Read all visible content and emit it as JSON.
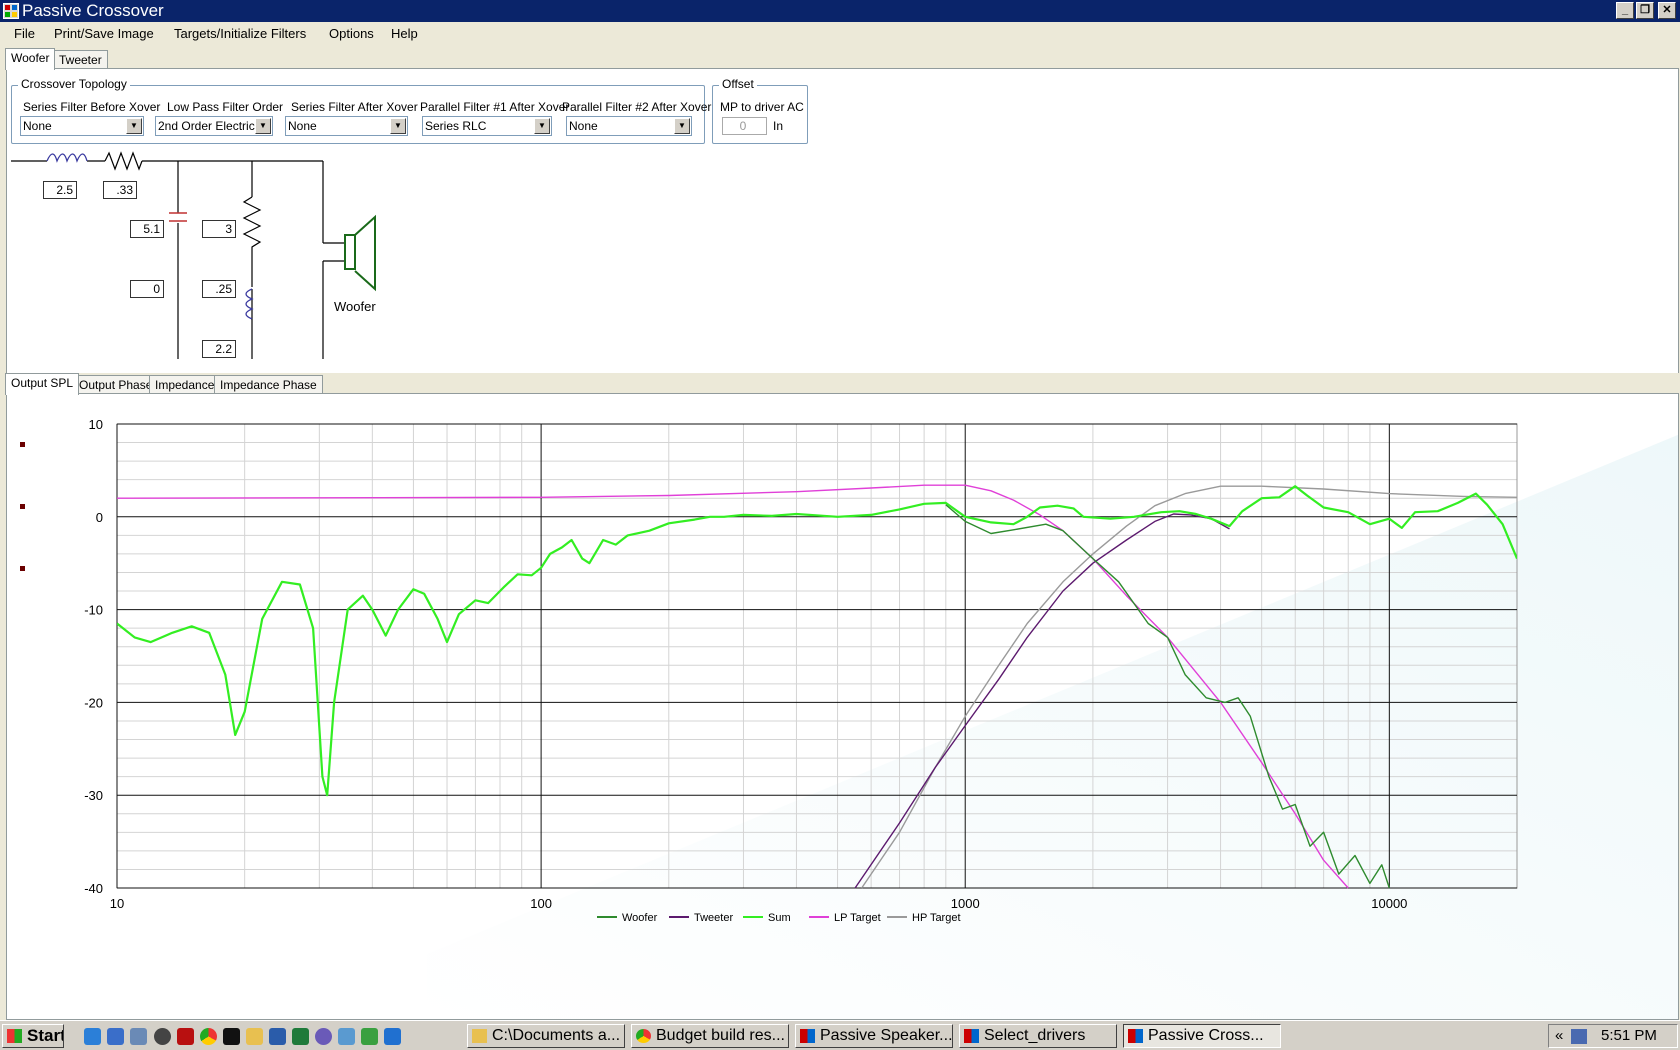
{
  "window": {
    "title": "Passive Crossover"
  },
  "menu": [
    "File",
    "Print/Save Image",
    "Targets/Initialize Filters",
    "Options",
    "Help"
  ],
  "driver_tabs": [
    {
      "label": "Woofer",
      "active": true
    },
    {
      "label": "Tweeter",
      "active": false
    }
  ],
  "topology": {
    "group_title": "Crossover Topology",
    "fields": [
      {
        "label": "Series Filter Before Xover",
        "value": "None"
      },
      {
        "label": "Low Pass Filter Order",
        "value": "2nd Order Electrical"
      },
      {
        "label": "Series Filter After Xover",
        "value": "None"
      },
      {
        "label": "Parallel Filter #1 After Xover",
        "value": "Series RLC"
      },
      {
        "label": "Parallel Filter #2 After Xover",
        "value": "None"
      }
    ]
  },
  "offset": {
    "group_title": "Offset",
    "label": "MP to driver AC",
    "value": "0",
    "unit": "In"
  },
  "schematic": {
    "series_inductor": "2.5",
    "series_resistor": ".33",
    "shunt_cap": "5.1",
    "shunt_res": "0",
    "rlc_res": "3",
    "rlc_ind": ".25",
    "rlc_cap": "2.2",
    "driver_label": "Woofer"
  },
  "chart_tabs": [
    {
      "label": "Output SPL",
      "active": true
    },
    {
      "label": "Output Phase",
      "active": false
    },
    {
      "label": "Impedance",
      "active": false
    },
    {
      "label": "Impedance Phase",
      "active": false
    }
  ],
  "chart_data": {
    "type": "line",
    "xscale": "log",
    "xlim": [
      10,
      20000
    ],
    "ylim": [
      -40,
      10
    ],
    "x_ticks": [
      "10",
      "100",
      "1000",
      "10000"
    ],
    "y_ticks": [
      "10",
      "0",
      "-10",
      "-20",
      "-30",
      "-40"
    ],
    "grid": true,
    "legend_position": "bottom",
    "series": [
      {
        "name": "Woofer",
        "color": "#2e8b2e",
        "points": [
          [
            900,
            1.3
          ],
          [
            1000,
            -0.5
          ],
          [
            1150,
            -1.8
          ],
          [
            1300,
            -1.4
          ],
          [
            1550,
            -0.8
          ],
          [
            1700,
            -1.5
          ],
          [
            2000,
            -4.5
          ],
          [
            2300,
            -7
          ],
          [
            2700,
            -11.5
          ],
          [
            3000,
            -13
          ],
          [
            3300,
            -17
          ],
          [
            3700,
            -19.5
          ],
          [
            4100,
            -20
          ],
          [
            4400,
            -19.5
          ],
          [
            4700,
            -21.5
          ],
          [
            5200,
            -28
          ],
          [
            5600,
            -31.5
          ],
          [
            6000,
            -31
          ],
          [
            6500,
            -35.5
          ],
          [
            7000,
            -34
          ],
          [
            7600,
            -38.5
          ],
          [
            8300,
            -36.5
          ],
          [
            9000,
            -39.5
          ],
          [
            9600,
            -37.5
          ],
          [
            10000,
            -40
          ]
        ]
      },
      {
        "name": "Tweeter",
        "color": "#5c1a6e",
        "points": [
          [
            550,
            -40
          ],
          [
            700,
            -33
          ],
          [
            850,
            -27
          ],
          [
            1000,
            -22.5
          ],
          [
            1200,
            -17.5
          ],
          [
            1400,
            -13
          ],
          [
            1700,
            -8
          ],
          [
            2000,
            -5
          ],
          [
            2400,
            -2.5
          ],
          [
            2800,
            -0.5
          ],
          [
            3100,
            0.3
          ],
          [
            3400,
            0.2
          ],
          [
            3800,
            -0.2
          ],
          [
            4200,
            -1.3
          ]
        ]
      },
      {
        "name": "Sum",
        "color": "#33ee22",
        "points": [
          [
            10,
            -11.5
          ],
          [
            11,
            -13
          ],
          [
            12,
            -13.5
          ],
          [
            13.5,
            -12.5
          ],
          [
            15,
            -11.8
          ],
          [
            16.5,
            -12.5
          ],
          [
            18,
            -17
          ],
          [
            19,
            -23.5
          ],
          [
            20,
            -21
          ],
          [
            22,
            -11
          ],
          [
            24.5,
            -7
          ],
          [
            27,
            -7.3
          ],
          [
            29,
            -12
          ],
          [
            30.5,
            -28
          ],
          [
            31.3,
            -30
          ],
          [
            32.5,
            -20
          ],
          [
            35,
            -10
          ],
          [
            38,
            -8.5
          ],
          [
            40,
            -10
          ],
          [
            43,
            -12.8
          ],
          [
            46,
            -10
          ],
          [
            50,
            -7.8
          ],
          [
            53,
            -8.3
          ],
          [
            57,
            -11
          ],
          [
            60,
            -13.5
          ],
          [
            64,
            -10.5
          ],
          [
            70,
            -9
          ],
          [
            75,
            -9.3
          ],
          [
            82,
            -7.5
          ],
          [
            88,
            -6.2
          ],
          [
            95,
            -6.3
          ],
          [
            100,
            -5.5
          ],
          [
            105,
            -4
          ],
          [
            112,
            -3.3
          ],
          [
            118,
            -2.5
          ],
          [
            125,
            -4.5
          ],
          [
            130,
            -5
          ],
          [
            140,
            -2.5
          ],
          [
            150,
            -3
          ],
          [
            160,
            -2
          ],
          [
            180,
            -1.5
          ],
          [
            200,
            -0.7
          ],
          [
            230,
            -0.3
          ],
          [
            250,
            0
          ],
          [
            270,
            0
          ],
          [
            300,
            0.2
          ],
          [
            350,
            0.1
          ],
          [
            400,
            0.3
          ],
          [
            500,
            0
          ],
          [
            600,
            0.2
          ],
          [
            700,
            0.8
          ],
          [
            800,
            1.4
          ],
          [
            900,
            1.5
          ],
          [
            1000,
            0
          ],
          [
            1150,
            -0.6
          ],
          [
            1300,
            -0.8
          ],
          [
            1400,
            0
          ],
          [
            1500,
            1
          ],
          [
            1650,
            1.2
          ],
          [
            1800,
            0.9
          ],
          [
            1900,
            0
          ],
          [
            2200,
            -0.2
          ],
          [
            2500,
            0
          ],
          [
            2900,
            0.5
          ],
          [
            3200,
            0.6
          ],
          [
            3500,
            0.3
          ],
          [
            3800,
            -0.2
          ],
          [
            4200,
            -1
          ],
          [
            4500,
            0.6
          ],
          [
            5000,
            2
          ],
          [
            5500,
            2.1
          ],
          [
            6000,
            3.3
          ],
          [
            6400,
            2.3
          ],
          [
            7000,
            1
          ],
          [
            8000,
            0.5
          ],
          [
            9000,
            -0.8
          ],
          [
            10000,
            -0.2
          ],
          [
            10700,
            -1.2
          ],
          [
            11500,
            0.5
          ],
          [
            13000,
            0.6
          ],
          [
            14500,
            1.5
          ],
          [
            16000,
            2.5
          ],
          [
            17000,
            1.3
          ],
          [
            18500,
            -0.8
          ],
          [
            20000,
            -4.5
          ]
        ]
      },
      {
        "name": "LP Target",
        "color": "#e040d8",
        "points": [
          [
            10,
            2
          ],
          [
            100,
            2.1
          ],
          [
            200,
            2.3
          ],
          [
            400,
            2.7
          ],
          [
            600,
            3.1
          ],
          [
            800,
            3.4
          ],
          [
            1000,
            3.4
          ],
          [
            1150,
            2.8
          ],
          [
            1300,
            1.8
          ],
          [
            1500,
            0.2
          ],
          [
            1700,
            -1.5
          ],
          [
            2000,
            -4.5
          ],
          [
            2400,
            -8.5
          ],
          [
            3000,
            -13
          ],
          [
            4000,
            -20
          ],
          [
            5000,
            -26.5
          ],
          [
            6000,
            -32
          ],
          [
            7000,
            -37
          ],
          [
            8000,
            -40
          ]
        ]
      },
      {
        "name": "HP Target",
        "color": "#9a9a9a",
        "points": [
          [
            570,
            -40
          ],
          [
            700,
            -34
          ],
          [
            850,
            -27
          ],
          [
            1000,
            -21.5
          ],
          [
            1200,
            -16
          ],
          [
            1400,
            -11.5
          ],
          [
            1700,
            -7
          ],
          [
            2000,
            -4
          ],
          [
            2400,
            -1
          ],
          [
            2800,
            1.2
          ],
          [
            3300,
            2.5
          ],
          [
            4000,
            3.3
          ],
          [
            5000,
            3.3
          ],
          [
            7000,
            3
          ],
          [
            10000,
            2.5
          ],
          [
            15000,
            2.2
          ],
          [
            20000,
            2.1
          ]
        ]
      }
    ]
  },
  "taskbar": {
    "start": "Start",
    "items": [
      {
        "label": "C:\\Documents a...",
        "active": false
      },
      {
        "label": "Budget build res...",
        "active": false
      },
      {
        "label": "Passive Speaker...",
        "active": false
      },
      {
        "label": "Select_drivers",
        "active": false
      },
      {
        "label": "Passive Cross...",
        "active": true
      }
    ],
    "tray_chevron": "«",
    "clock": "5:51 PM"
  }
}
